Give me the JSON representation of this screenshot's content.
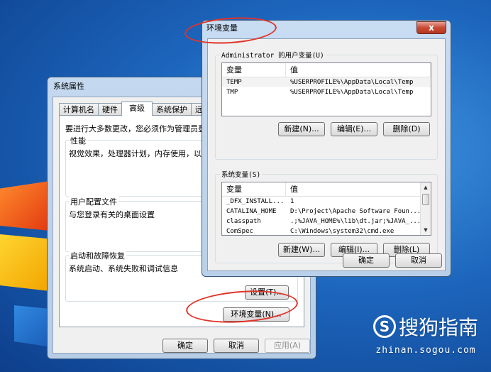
{
  "system_properties": {
    "title": "系统属性",
    "tabs": [
      "计算机名",
      "硬件",
      "高级",
      "系统保护",
      "远"
    ],
    "active_tab": "高级",
    "admin_note": "要进行大多数更改，您必须作为管理员登",
    "performance": {
      "legend": "性能",
      "desc": "视觉效果，处理器计划，内存使用，以"
    },
    "user_profiles": {
      "legend": "用户配置文件",
      "desc": "与您登录有关的桌面设置"
    },
    "startup": {
      "legend": "启动和故障恢复",
      "desc": "系统启动、系统失败和调试信息",
      "settings_button": "设置(T)..."
    },
    "env_button": "环境变量(N)...",
    "ok_button": "确定",
    "cancel_button": "取消",
    "apply_button": "应用(A)"
  },
  "env_vars": {
    "title": "环境变量",
    "close_glyph": "x",
    "user_group": {
      "legend": "Administrator 的用户变量(U)",
      "headers": [
        "变量",
        "值"
      ],
      "rows": [
        {
          "name": "TEMP",
          "value": "%USERPROFILE%\\AppData\\Local\\Temp"
        },
        {
          "name": "TMP",
          "value": "%USERPROFILE%\\AppData\\Local\\Temp"
        }
      ],
      "new_button": "新建(N)...",
      "edit_button": "编辑(E)...",
      "delete_button": "删除(D)"
    },
    "system_group": {
      "legend": "系统变量(S)",
      "headers": [
        "变量",
        "值"
      ],
      "rows": [
        {
          "name": "_DFX_INSTALL...",
          "value": "1"
        },
        {
          "name": "CATALINA_HOME",
          "value": "D:\\Project\\Apache Software Foun..."
        },
        {
          "name": "classpath",
          "value": ".;%JAVA_HOME%\\lib\\dt.jar;%JAVA_..."
        },
        {
          "name": "ComSpec",
          "value": "C:\\Windows\\system32\\cmd.exe"
        }
      ],
      "new_button": "新建(W)...",
      "edit_button": "编辑(I)...",
      "delete_button": "删除(L)"
    },
    "ok_button": "确定",
    "cancel_button": "取消"
  },
  "watermark": {
    "icon": "S",
    "brand": "搜狗指南",
    "url": "zhinan.sogou.com"
  },
  "colors": {
    "highlight": "#e0342a",
    "desktop": "#1d66bd"
  }
}
